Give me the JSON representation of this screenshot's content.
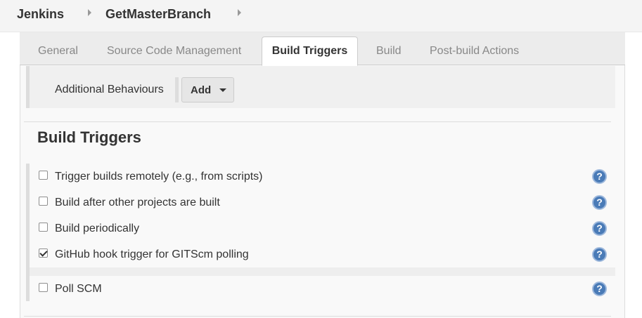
{
  "breadcrumb": {
    "items": [
      {
        "label": "Jenkins"
      },
      {
        "label": "GetMasterBranch"
      }
    ]
  },
  "tabs": [
    {
      "label": "General",
      "active": false
    },
    {
      "label": "Source Code Management",
      "active": false
    },
    {
      "label": "Build Triggers",
      "active": true
    },
    {
      "label": "Build",
      "active": false
    },
    {
      "label": "Post-build Actions",
      "active": false
    }
  ],
  "behaviours": {
    "label": "Additional Behaviours",
    "add_label": "Add"
  },
  "section": {
    "title": "Build Triggers"
  },
  "triggers": [
    {
      "label": "Trigger builds remotely (e.g., from scripts)",
      "checked": false
    },
    {
      "label": "Build after other projects are built",
      "checked": false
    },
    {
      "label": "Build periodically",
      "checked": false
    },
    {
      "label": "GitHub hook trigger for GITScm polling",
      "checked": true
    },
    {
      "label": "Poll SCM",
      "checked": false
    }
  ],
  "help": {
    "glyph": "?"
  },
  "colors": {
    "help_icon": "#4a7bb7",
    "active_tab_bg": "#ffffff"
  }
}
